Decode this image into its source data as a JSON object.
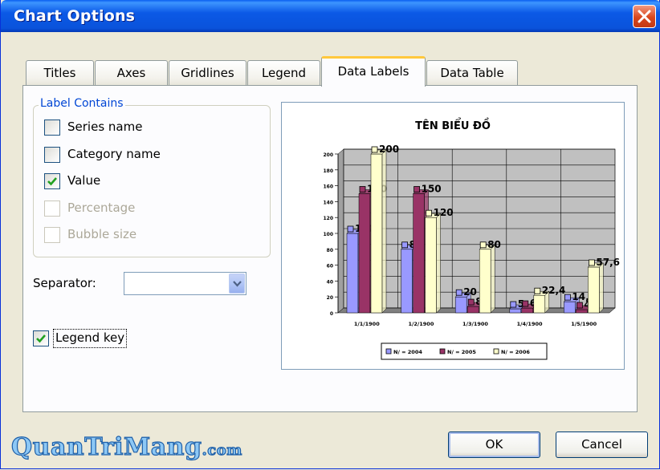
{
  "window": {
    "title": "Chart Options"
  },
  "tabs": [
    {
      "label": "Titles",
      "active": false
    },
    {
      "label": "Axes",
      "active": false
    },
    {
      "label": "Gridlines",
      "active": false
    },
    {
      "label": "Legend",
      "active": false
    },
    {
      "label": "Data Labels",
      "active": true
    },
    {
      "label": "Data Table",
      "active": false
    }
  ],
  "label_contains": {
    "group_label": "Label Contains",
    "options": [
      {
        "label": "Series name",
        "checked": false,
        "enabled": true
      },
      {
        "label": "Category name",
        "checked": false,
        "enabled": true
      },
      {
        "label": "Value",
        "checked": true,
        "enabled": true
      },
      {
        "label": "Percentage",
        "checked": false,
        "enabled": false
      },
      {
        "label": "Bubble size",
        "checked": false,
        "enabled": false
      }
    ]
  },
  "separator": {
    "label": "Separator:",
    "value": ""
  },
  "legend_key": {
    "label": "Legend key",
    "checked": true
  },
  "chart_data": {
    "type": "bar",
    "title": "TÊN BIỂU ĐỒ",
    "categories": [
      "1/1/1900",
      "1/2/1900",
      "1/3/1900",
      "1/4/1900",
      "1/5/1900"
    ],
    "series": [
      {
        "name": "N/ = 2004",
        "values": [
          100,
          80,
          20,
          5,
          14
        ],
        "color": "#9999FF"
      },
      {
        "name": "N/ = 2005",
        "values": [
          150,
          150,
          8,
          6,
          4
        ],
        "color": "#993366"
      },
      {
        "name": "N/ = 2006",
        "values": [
          200,
          120,
          80,
          22,
          57.6
        ],
        "color": "#FFFFCC"
      }
    ],
    "data_labels": [
      [
        "100",
        "80",
        "20",
        "5",
        "14,4"
      ],
      [
        "150",
        "150",
        "8",
        "6",
        "4"
      ],
      [
        "200",
        "120",
        "80",
        "22,4",
        "57,6"
      ]
    ],
    "yticks": [
      "0",
      "20",
      "40",
      "60",
      "80",
      "100",
      "120",
      "140",
      "160",
      "180",
      "200"
    ],
    "ylim": [
      0,
      200
    ],
    "grid": true,
    "legend_position": "bottom",
    "plot_background": "#C0C0C0"
  },
  "buttons": {
    "ok": "OK",
    "cancel": "Cancel"
  },
  "watermark": {
    "main": "QuanTriMang",
    "suffix": ".com"
  }
}
